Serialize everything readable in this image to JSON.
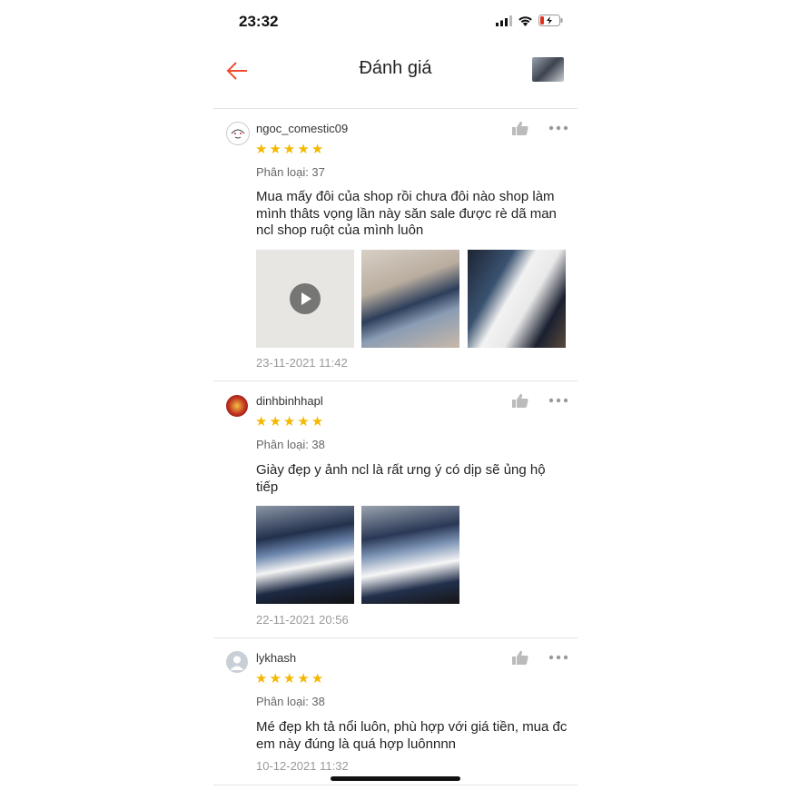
{
  "status_bar": {
    "time": "23:32",
    "battery_color": "#e0301e"
  },
  "nav": {
    "title": "Đánh giá",
    "accent_color": "#ee4d2d",
    "back_icon": "arrow-left-icon"
  },
  "reviews": [
    {
      "username": "ngoc_comestic09",
      "rating": 5,
      "variant": "Phân loại: 37",
      "comment": "Mua mấy đôi của shop rồi chưa đôi nào shop làm mình thâts vọng lần này săn sale được rè dã man ncl shop ruột của mình luôn",
      "media": [
        "video",
        "photo",
        "photo"
      ],
      "date": "23-11-2021 11:42"
    },
    {
      "username": "dinhbinhhapl",
      "rating": 5,
      "variant": "Phân loại: 38",
      "comment": "Giày đẹp y ảnh ncl là rất ưng ý có dịp sẽ ủng hộ tiếp",
      "media": [
        "photo",
        "photo"
      ],
      "date": "22-11-2021 20:56"
    },
    {
      "username": "lykhash",
      "rating": 5,
      "variant": "Phân loại: 38",
      "comment": "Mé đẹp kh tả nổi luôn, phù hợp với giá tiền, mua đc em này đúng là quá hợp luônnnn",
      "media": [],
      "date": "10-12-2021 11:32"
    }
  ],
  "colors": {
    "star": "#f5b800",
    "muted_text": "#999999",
    "divider": "#e5e5e5"
  }
}
